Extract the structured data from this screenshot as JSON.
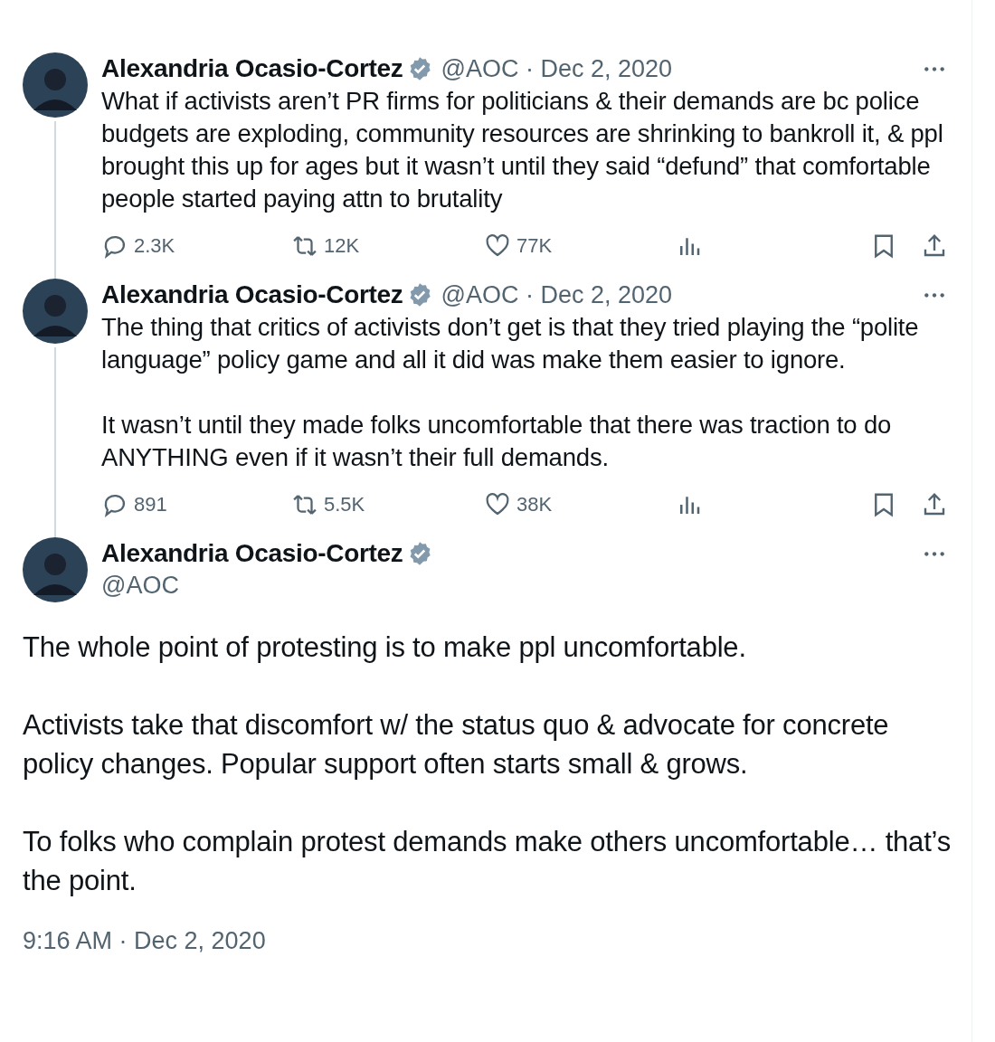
{
  "thread": [
    {
      "name": "Alexandria Ocasio-Cortez",
      "verified": true,
      "handle": "@AOC",
      "separator": "·",
      "date": "Dec 2, 2020",
      "paragraphs": [
        "What if activists aren’t PR firms for politicians & their demands are bc police budgets are exploding, community resources are shrinking to bankroll it, & ppl brought this up for ages but it wasn’t until they said “defund” that comfortable people started paying attn to brutality"
      ],
      "replies": "2.3K",
      "reposts": "12K",
      "likes": "77K"
    },
    {
      "name": "Alexandria Ocasio-Cortez",
      "verified": true,
      "handle": "@AOC",
      "separator": "·",
      "date": "Dec 2, 2020",
      "paragraphs": [
        "The thing that critics of activists don’t get is that they tried playing the “polite language” policy game and all it did was make them easier to ignore.",
        "It wasn’t until they made folks uncomfortable that there was traction to do ANYTHING even if it wasn’t their full demands."
      ],
      "replies": "891",
      "reposts": "5.5K",
      "likes": "38K"
    }
  ],
  "main": {
    "name": "Alexandria Ocasio-Cortez",
    "verified": true,
    "handle": "@AOC",
    "paragraphs": [
      "The whole point of protesting is to make ppl uncomfortable.",
      "Activists take that discomfort w/ the status quo & advocate for concrete policy changes. Popular support often starts small & grows.",
      "To folks who complain protest demands make others uncomfortable… that’s the point."
    ],
    "timestamp": "9:16 AM · Dec 2, 2020"
  }
}
